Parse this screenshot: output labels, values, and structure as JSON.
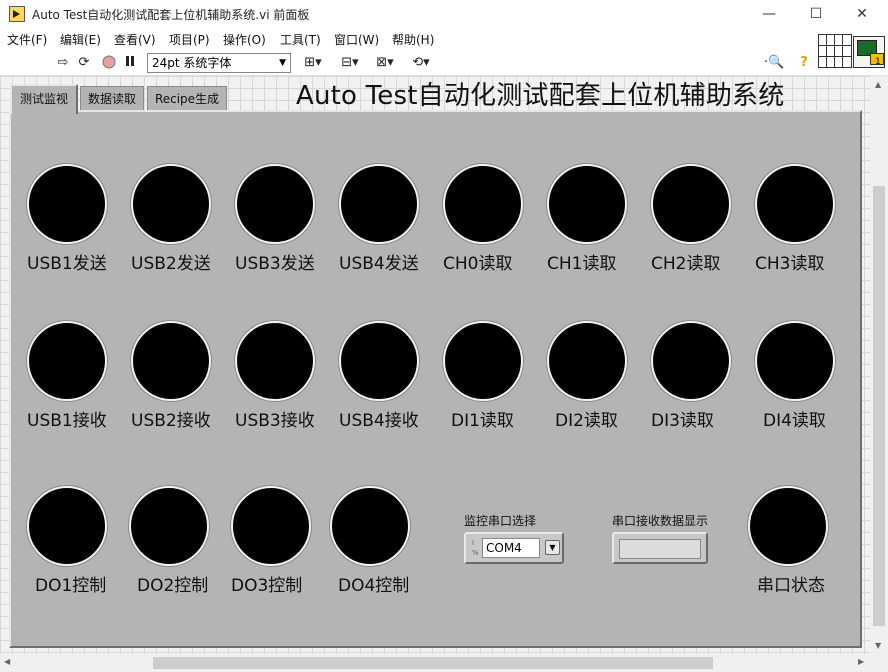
{
  "window": {
    "title": "Auto Test自动化测试配套上位机辅助系统.vi 前面板",
    "minimize": "—",
    "maximize": "☐",
    "close": "✕"
  },
  "menu": [
    "文件(F)",
    "编辑(E)",
    "查看(V)",
    "项目(P)",
    "操作(O)",
    "工具(T)",
    "窗口(W)",
    "帮助(H)"
  ],
  "toolbar": {
    "font": "24pt 系统字体"
  },
  "connector_pane_number": "1",
  "tabs": [
    {
      "label": "测试监视",
      "active": true
    },
    {
      "label": "数据读取",
      "active": false
    },
    {
      "label": "Recipe生成",
      "active": false
    }
  ],
  "heading": "Auto Test自动化测试配套上位机辅助系统",
  "leds": {
    "row1": [
      "USB1发送",
      "USB2发送",
      "USB3发送",
      "USB4发送",
      "CH0读取",
      "CH1读取",
      "CH2读取",
      "CH3读取"
    ],
    "row2": [
      "USB1接收",
      "USB2接收",
      "USB3接收",
      "USB4接收",
      "DI1读取",
      "DI2读取",
      "DI3读取",
      "DI4读取"
    ],
    "row3": [
      "DO1控制",
      "DO2控制",
      "DO3控制",
      "DO4控制"
    ],
    "serial_status": "串口状态"
  },
  "serial_port": {
    "label": "监控串口选择",
    "value": "COM4"
  },
  "receive_display": {
    "label": "串口接收数据显示",
    "value": ""
  },
  "colors": {
    "panel": "#b4b4b4",
    "led_off": "#000000"
  }
}
